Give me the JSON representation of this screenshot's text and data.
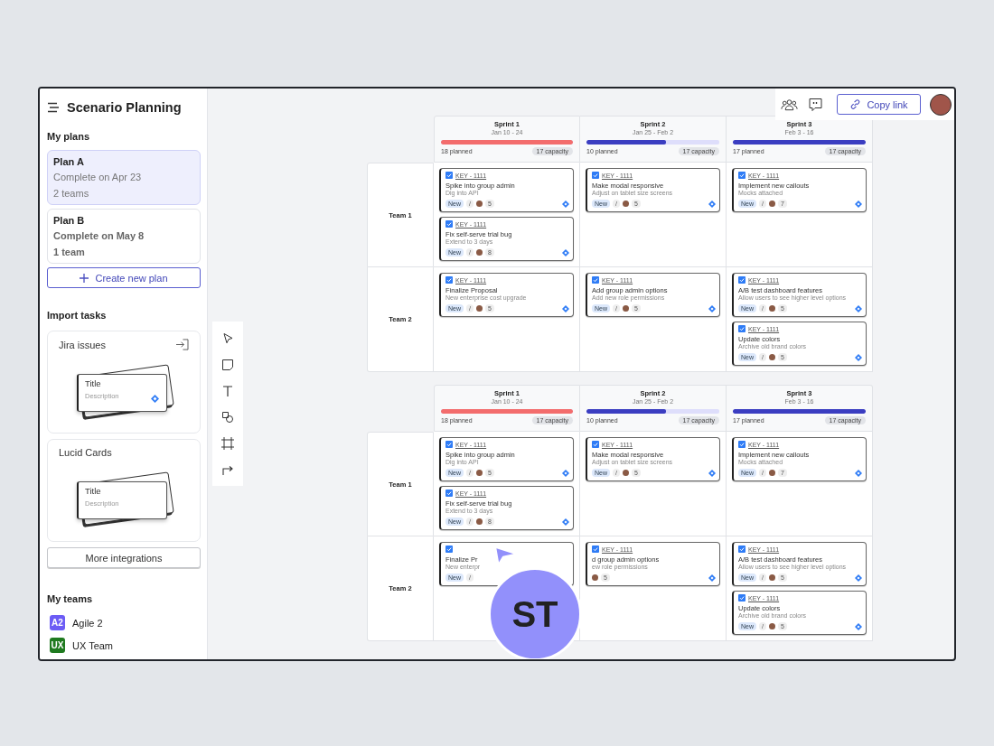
{
  "sidebar": {
    "title": "Scenario Planning",
    "plans_heading": "My plans",
    "plans": [
      {
        "name": "Plan A",
        "completion": "Complete on Apr 23",
        "teams": "2 teams",
        "selected": true
      },
      {
        "name": "Plan B",
        "completion": "Complete on May 8",
        "teams": "1 team",
        "selected": false
      }
    ],
    "create_button": "Create new plan",
    "import_heading": "Import tasks",
    "integrations": [
      {
        "kind": "jira",
        "name": "Jira issues",
        "card_title": "Title",
        "card_description": "Description"
      },
      {
        "kind": "lucid",
        "name": "Lucid Cards",
        "card_title": "Title",
        "card_description": "Description"
      }
    ],
    "more_button": "More integrations",
    "teams_heading": "My teams",
    "teams": [
      {
        "initials": "A2",
        "name": "Agile 2",
        "color": "#6c5cf5"
      },
      {
        "initials": "UX",
        "name": "UX Team",
        "color": "#1f7a1f"
      }
    ]
  },
  "top_bar": {
    "copy_link": "Copy link"
  },
  "boards": [
    {
      "sprints": [
        {
          "name": "Sprint 1",
          "dates": "Jan 10 - 24",
          "level": 1,
          "over_capacity": true,
          "planned": "18 planned",
          "capacity": "17 capacity"
        },
        {
          "name": "Sprint 2",
          "dates": "Jan 25 - Feb 2",
          "level": 0.6,
          "over_capacity": false,
          "planned": "10 planned",
          "capacity": "17 capacity"
        },
        {
          "name": "Sprint 3",
          "dates": "Feb 3 - 16",
          "level": 1,
          "over_capacity": false,
          "planned": "17 planned",
          "capacity": "17 capacity"
        }
      ],
      "rows": [
        {
          "team": "Team 1",
          "cells": [
            {
              "cards": [
                {
                  "checked": true,
                  "key": "KEY - 1111",
                  "title": "Spike into group admin",
                  "description": "Dig into API",
                  "status": "New",
                  "assignee_glyph": "/",
                  "assigned": true,
                  "points": "5",
                  "linked": true
                },
                {
                  "checked": true,
                  "key": "KEY - 1111",
                  "title": "Fix self-serve trial bug",
                  "description": "Extend to 3 days",
                  "status": "New",
                  "assignee_glyph": "/",
                  "assigned": true,
                  "points": "8",
                  "linked": true
                }
              ]
            },
            {
              "cards": [
                {
                  "checked": true,
                  "key": "KEY - 1111",
                  "title": "Make modal responsive",
                  "description": "Adjust on tablet size screens",
                  "status": "New",
                  "assignee_glyph": "/",
                  "assigned": true,
                  "points": "5",
                  "linked": true
                }
              ]
            },
            {
              "cards": [
                {
                  "checked": true,
                  "key": "KEY - 1111",
                  "title": "Implement new callouts",
                  "description": "Mocks attached",
                  "status": "New",
                  "assignee_glyph": "/",
                  "assigned": true,
                  "points": "7",
                  "linked": true
                }
              ]
            }
          ]
        },
        {
          "team": "Team 2",
          "cells": [
            {
              "cards": [
                {
                  "checked": true,
                  "key": "KEY - 1111",
                  "title": "Finalize Proposal",
                  "description": "New enterprise cost upgrade",
                  "status": "New",
                  "assignee_glyph": "/",
                  "assigned": true,
                  "points": "5",
                  "linked": true
                }
              ]
            },
            {
              "cards": [
                {
                  "checked": true,
                  "key": "KEY - 1111",
                  "title": "Add group admin options",
                  "description": "Add new role permissions",
                  "status": "New",
                  "assignee_glyph": "/",
                  "assigned": true,
                  "points": "5",
                  "linked": true
                }
              ]
            },
            {
              "cards": [
                {
                  "checked": true,
                  "key": "KEY - 1111",
                  "title": "A/B test dashboard features",
                  "description": "Allow users to see higher level options",
                  "status": "New",
                  "assignee_glyph": "/",
                  "assigned": true,
                  "points": "5",
                  "linked": true
                },
                {
                  "checked": true,
                  "key": "KEY - 1111",
                  "title": "Update colors",
                  "description": "Archive old brand colors",
                  "status": "New",
                  "assignee_glyph": "/",
                  "assigned": true,
                  "points": "5",
                  "linked": true
                }
              ]
            }
          ]
        }
      ]
    },
    {
      "sprints": [
        {
          "name": "Sprint 1",
          "dates": "Jan 10 - 24",
          "level": 1,
          "over_capacity": true,
          "planned": "18 planned",
          "capacity": "17 capacity"
        },
        {
          "name": "Sprint 2",
          "dates": "Jan 25 - Feb 2",
          "level": 0.6,
          "over_capacity": false,
          "planned": "10 planned",
          "capacity": "17 capacity"
        },
        {
          "name": "Sprint 3",
          "dates": "Feb 3 - 16",
          "level": 1,
          "over_capacity": false,
          "planned": "17 planned",
          "capacity": "17 capacity"
        }
      ],
      "rows": [
        {
          "team": "Team 1",
          "cells": [
            {
              "cards": [
                {
                  "checked": true,
                  "key": "KEY - 1111",
                  "title": "Spike into group admin",
                  "description": "Dig into API",
                  "status": "New",
                  "assignee_glyph": "/",
                  "assigned": true,
                  "points": "5",
                  "linked": true
                },
                {
                  "checked": true,
                  "key": "KEY - 1111",
                  "title": "Fix self-serve trial bug",
                  "description": "Extend to 3 days",
                  "status": "New",
                  "assignee_glyph": "/",
                  "assigned": true,
                  "points": "8",
                  "linked": true
                }
              ]
            },
            {
              "cards": [
                {
                  "checked": true,
                  "key": "KEY - 1111",
                  "title": "Make modal responsive",
                  "description": "Adjust on tablet size screens",
                  "status": "New",
                  "assignee_glyph": "/",
                  "assigned": true,
                  "points": "5",
                  "linked": true
                }
              ]
            },
            {
              "cards": [
                {
                  "checked": true,
                  "key": "KEY - 1111",
                  "title": "Implement new callouts",
                  "description": "Mocks attached",
                  "status": "New",
                  "assignee_glyph": "/",
                  "assigned": true,
                  "points": "7",
                  "linked": true
                }
              ]
            }
          ]
        },
        {
          "team": "Team 2",
          "cells": [
            {
              "cards": [
                {
                  "checked": true,
                  "title": "Finalize Pr",
                  "description": "New enterpr",
                  "status": "New",
                  "assignee_glyph": "/",
                  "assigned": false,
                  "linked": false
                }
              ]
            },
            {
              "cards": [
                {
                  "checked": true,
                  "key": "KEY - 1111",
                  "title": "d group admin options",
                  "description": "ew role permissions",
                  "assigned": true,
                  "points": "5",
                  "linked": true
                }
              ]
            },
            {
              "cards": [
                {
                  "checked": true,
                  "key": "KEY - 1111",
                  "title": "A/B test dashboard features",
                  "description": "Allow users to see higher level options",
                  "status": "New",
                  "assignee_glyph": "/",
                  "assigned": true,
                  "points": "5",
                  "linked": true
                },
                {
                  "checked": true,
                  "key": "KEY - 1111",
                  "title": "Update colors",
                  "description": "Archive old brand colors",
                  "status": "New",
                  "assignee_glyph": "/",
                  "assigned": true,
                  "points": "5",
                  "linked": true
                }
              ]
            }
          ]
        }
      ]
    }
  ],
  "cursor": {
    "initials": "ST"
  }
}
